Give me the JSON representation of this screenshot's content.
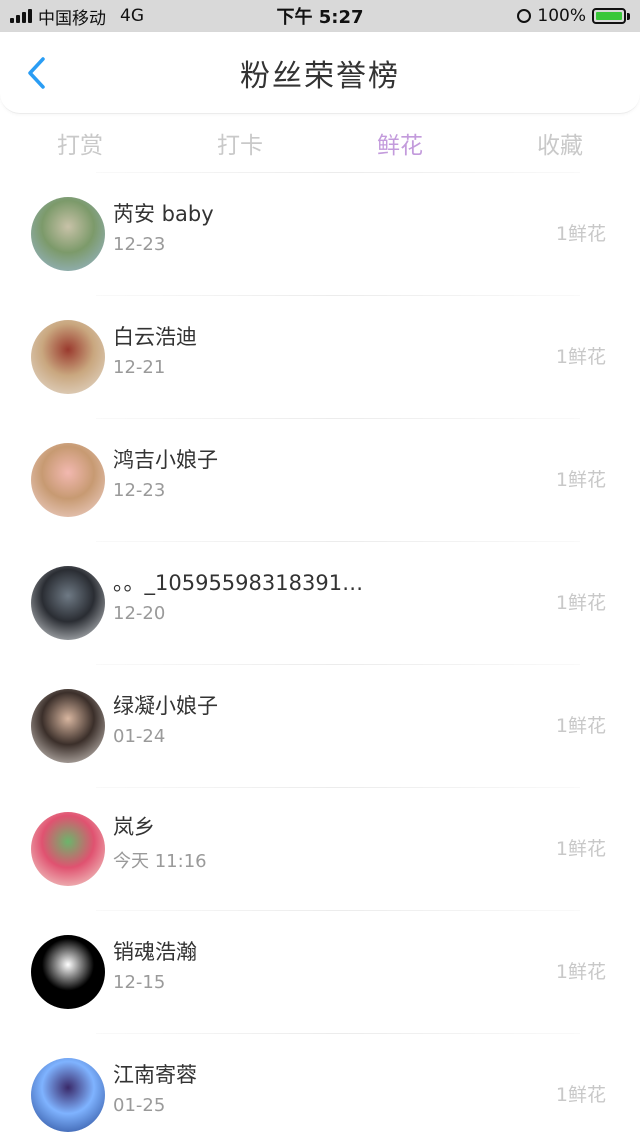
{
  "status_bar": {
    "carrier": "中国移动",
    "network": "4G",
    "time": "下午 5:27",
    "battery": "100%"
  },
  "nav": {
    "title": "粉丝荣誉榜"
  },
  "tabs": [
    {
      "label": "打赏",
      "active": false
    },
    {
      "label": "打卡",
      "active": false
    },
    {
      "label": "鲜花",
      "active": true
    },
    {
      "label": "收藏",
      "active": false
    }
  ],
  "fans": [
    {
      "name": "芮安 baby",
      "time": "12-23",
      "amount": "1鲜花",
      "avatar_colors": [
        "#9bb9d8",
        "#7c9a6a",
        "#c8c2a8"
      ]
    },
    {
      "name": "白云浩迪",
      "time": "12-21",
      "amount": "1鲜花",
      "avatar_colors": [
        "#e8e0d6",
        "#c9a77f",
        "#9a3a2e"
      ]
    },
    {
      "name": "鸿吉小娘子",
      "time": "12-23",
      "amount": "1鲜花",
      "avatar_colors": [
        "#f4d7d2",
        "#c79a72",
        "#f2b8b0"
      ]
    },
    {
      "name": "。。_105955983183915...",
      "time": "12-20",
      "amount": "1鲜花",
      "avatar_colors": [
        "#dfe3e6",
        "#2a2d33",
        "#6f7a85"
      ]
    },
    {
      "name": "绿凝小娘子",
      "time": "01-24",
      "amount": "1鲜花",
      "avatar_colors": [
        "#e8e2dc",
        "#3b2f2a",
        "#d8b6a0"
      ]
    },
    {
      "name": "岚乡",
      "time": "今天 11:16",
      "amount": "1鲜花",
      "avatar_colors": [
        "#f5e6d8",
        "#e05270",
        "#6bb56b"
      ]
    },
    {
      "name": "销魂浩瀚",
      "time": "12-15",
      "amount": "1鲜花",
      "avatar_colors": [
        "#000000",
        "#000000",
        "#ffffff"
      ]
    },
    {
      "name": "江南寄蓉",
      "time": "01-25",
      "amount": "1鲜花",
      "avatar_colors": [
        "#1f3f8a",
        "#7fb3ff",
        "#3a2a6a"
      ]
    }
  ]
}
